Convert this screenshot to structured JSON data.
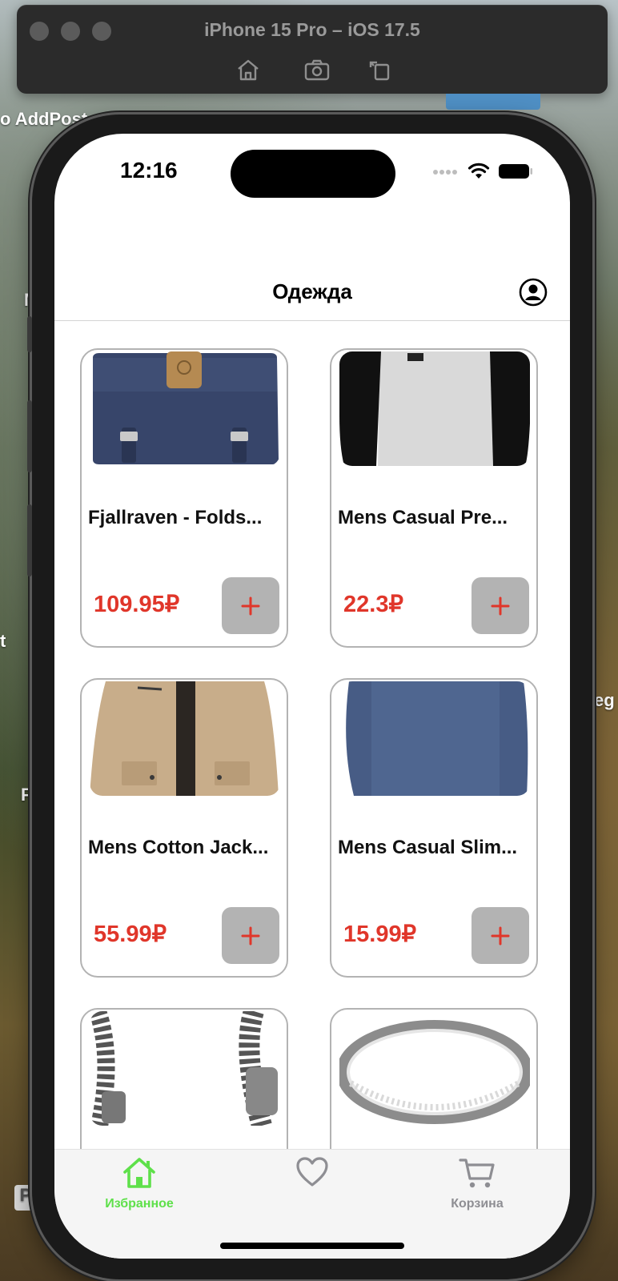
{
  "simulator": {
    "title": "iPhone 15 Pro – iOS 17.5",
    "toolbar_icons": [
      "home-icon",
      "screenshot-icon",
      "rotate-icon"
    ]
  },
  "background_labels": {
    "top_left": "o  AddPost",
    "mid_left_1": "M",
    "mid_left_2": "t",
    "mid_left_3": "F",
    "right": "eg",
    "bottom_left": "P"
  },
  "status_bar": {
    "time": "12:16"
  },
  "nav": {
    "title": "Одежда",
    "profile_icon": "person-circle-icon"
  },
  "products": [
    {
      "title": "Fjallraven - Folds...",
      "price": "109.95₽",
      "image": "blue-backpack"
    },
    {
      "title": "Mens Casual Pre...",
      "price": "22.3₽",
      "image": "raglan-tshirt"
    },
    {
      "title": "Mens Cotton Jack...",
      "price": "55.99₽",
      "image": "beige-jacket"
    },
    {
      "title": "Mens Casual Slim...",
      "price": "15.99₽",
      "image": "blue-longsleeve"
    },
    {
      "title": "",
      "price": "",
      "image": "silver-chain-bracelet"
    },
    {
      "title": "",
      "price": "",
      "image": "silver-ring"
    }
  ],
  "add_button_label": "+",
  "tabbar": {
    "tabs": [
      {
        "label": "Избранное",
        "icon": "home-icon",
        "active": true
      },
      {
        "label": "",
        "icon": "heart-icon",
        "active": false
      },
      {
        "label": "Корзина",
        "icon": "cart-icon",
        "active": false
      }
    ]
  },
  "colors": {
    "price": "#e0362a",
    "active_tab": "#5ee04a",
    "inactive_tab": "#8e8e93",
    "add_button_bg": "#b3b3b3"
  }
}
